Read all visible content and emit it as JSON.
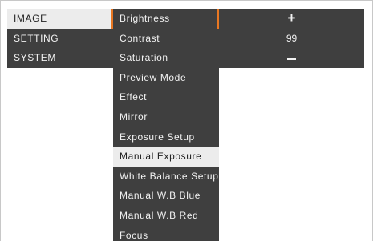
{
  "menu": {
    "categories": [
      {
        "label": "IMAGE",
        "selected": true
      },
      {
        "label": "SETTING",
        "selected": false
      },
      {
        "label": "SYSTEM",
        "selected": false
      }
    ],
    "items": [
      {
        "label": "Brightness",
        "selected": false
      },
      {
        "label": "Contrast",
        "selected": false
      },
      {
        "label": "Saturation",
        "selected": false
      },
      {
        "label": "Preview Mode",
        "selected": false
      },
      {
        "label": "Effect",
        "selected": false
      },
      {
        "label": "Mirror",
        "selected": false
      },
      {
        "label": "Exposure Setup",
        "selected": false
      },
      {
        "label": "Manual Exposure",
        "selected": true
      },
      {
        "label": "White Balance Setup",
        "selected": false
      },
      {
        "label": "Manual W.B Blue",
        "selected": false
      },
      {
        "label": "Manual W.B Red",
        "selected": false
      },
      {
        "label": "Focus",
        "selected": false
      }
    ]
  },
  "adjust": {
    "increase_symbol": "+",
    "value": "99",
    "decrease_icon": "minus-icon"
  },
  "colors": {
    "panel": "#3f3f3f",
    "selected_bg": "#ececec",
    "accent": "#e87722",
    "text": "#f2f2f2"
  }
}
